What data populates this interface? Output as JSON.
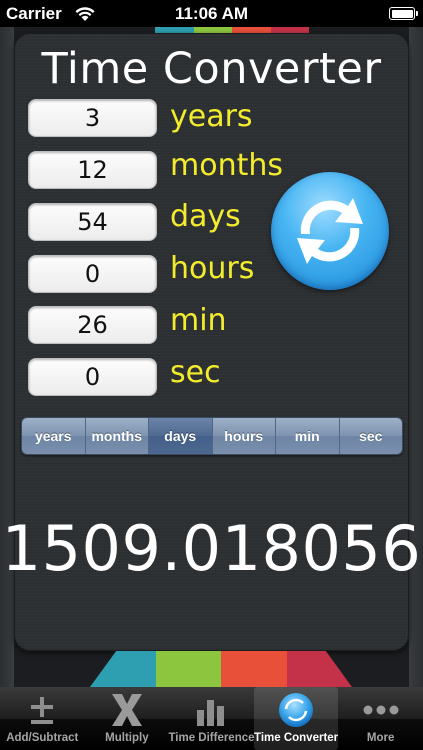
{
  "status_bar": {
    "carrier": "Carrier",
    "time": "11:06 AM"
  },
  "title": "Time Converter",
  "fields": [
    {
      "value": "3",
      "unit": "years"
    },
    {
      "value": "12",
      "unit": "months"
    },
    {
      "value": "54",
      "unit": "days"
    },
    {
      "value": "0",
      "unit": "hours"
    },
    {
      "value": "26",
      "unit": "min"
    },
    {
      "value": "0",
      "unit": "sec"
    }
  ],
  "segmented": {
    "options": [
      "years",
      "months",
      "days",
      "hours",
      "min",
      "sec"
    ],
    "selected": "days"
  },
  "result": "1509.018056",
  "tabs": [
    {
      "label": "Add/Subtract",
      "icon": "plus-minus-icon"
    },
    {
      "label": "Multiply",
      "icon": "multiply-icon"
    },
    {
      "label": "Time Difference",
      "icon": "bar-chart-icon"
    },
    {
      "label": "Time Converter",
      "icon": "convert-globe-icon"
    },
    {
      "label": "More",
      "icon": "more-dots-icon"
    }
  ],
  "selected_tab": "Time Converter",
  "colors": {
    "unit_text": "#f3ec2d",
    "accent_blue": "#47b5f2",
    "stripes": [
      "#2e9fb0",
      "#8cc63f",
      "#e8503a",
      "#c4324a"
    ]
  }
}
